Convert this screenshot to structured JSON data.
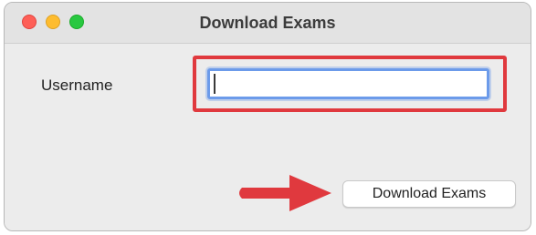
{
  "window": {
    "title": "Download Exams"
  },
  "form": {
    "username_label": "Username",
    "username_value": "",
    "submit_label": "Download Exams"
  },
  "colors": {
    "highlight": "#e0393e",
    "focus_ring": "#6c9bea",
    "close": "#fe5f57",
    "minimize": "#febc2e",
    "maximize": "#28c840"
  },
  "icons": {
    "annotation": "right-arrow-icon"
  }
}
